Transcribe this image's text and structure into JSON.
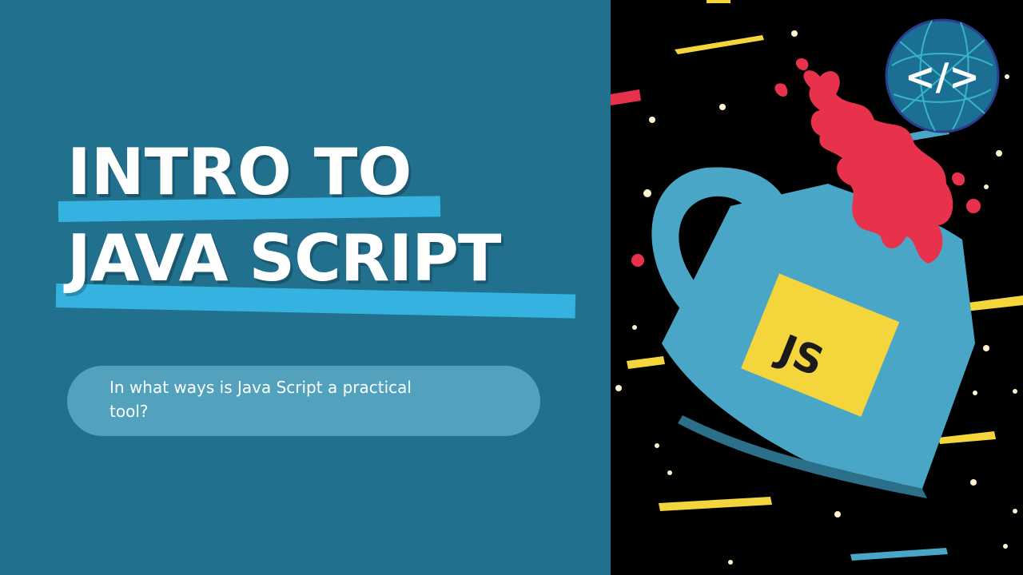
{
  "title": {
    "line1": "INTRO TO",
    "line2": "JAVA SCRIPT"
  },
  "subtitle": "In what ways is Java Script a practical tool?",
  "illustration": {
    "mug_label": "JS"
  },
  "logo": {
    "text": "</>"
  },
  "colors": {
    "left_background": "#21708d",
    "highlight": "#35b2e0",
    "pill": "#52a1bd",
    "right_background": "#000000",
    "mug": "#4aa6c6",
    "label": "#f5d53c",
    "splash": "#e8324c"
  }
}
